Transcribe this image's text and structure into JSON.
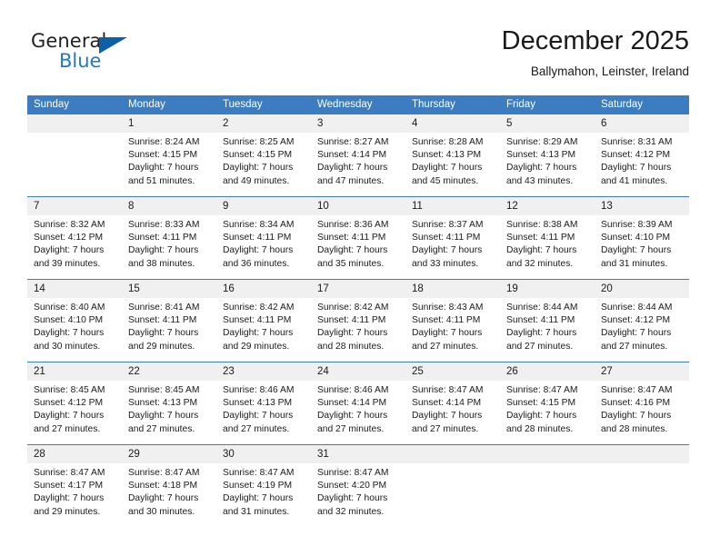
{
  "brand": {
    "name_part1": "General",
    "name_part2": "Blue",
    "triangle_color": "#0d5fa8",
    "blue_color": "#2079c7"
  },
  "header": {
    "title": "December 2025",
    "location": "Ballymahon, Leinster, Ireland"
  },
  "theme": {
    "header_row_bg": "#3c7cc0",
    "daynum_bg": "#f0f0f0",
    "row_divider": "#3c7cc0",
    "text": "#1a1a1a"
  },
  "weekday_headers": [
    "Sunday",
    "Monday",
    "Tuesday",
    "Wednesday",
    "Thursday",
    "Friday",
    "Saturday"
  ],
  "labels": {
    "sunrise_prefix": "Sunrise: ",
    "sunset_prefix": "Sunset: ",
    "daylight_prefix": "Daylight: "
  },
  "weeks": [
    [
      {
        "day": "",
        "blank": true,
        "line1": "",
        "line2": "",
        "line3": "",
        "line4": ""
      },
      {
        "day": "1",
        "line1": "Sunrise: 8:24 AM",
        "line2": "Sunset: 4:15 PM",
        "line3": "Daylight: 7 hours",
        "line4": "and 51 minutes."
      },
      {
        "day": "2",
        "line1": "Sunrise: 8:25 AM",
        "line2": "Sunset: 4:15 PM",
        "line3": "Daylight: 7 hours",
        "line4": "and 49 minutes."
      },
      {
        "day": "3",
        "line1": "Sunrise: 8:27 AM",
        "line2": "Sunset: 4:14 PM",
        "line3": "Daylight: 7 hours",
        "line4": "and 47 minutes."
      },
      {
        "day": "4",
        "line1": "Sunrise: 8:28 AM",
        "line2": "Sunset: 4:13 PM",
        "line3": "Daylight: 7 hours",
        "line4": "and 45 minutes."
      },
      {
        "day": "5",
        "line1": "Sunrise: 8:29 AM",
        "line2": "Sunset: 4:13 PM",
        "line3": "Daylight: 7 hours",
        "line4": "and 43 minutes."
      },
      {
        "day": "6",
        "line1": "Sunrise: 8:31 AM",
        "line2": "Sunset: 4:12 PM",
        "line3": "Daylight: 7 hours",
        "line4": "and 41 minutes."
      }
    ],
    [
      {
        "day": "7",
        "line1": "Sunrise: 8:32 AM",
        "line2": "Sunset: 4:12 PM",
        "line3": "Daylight: 7 hours",
        "line4": "and 39 minutes."
      },
      {
        "day": "8",
        "line1": "Sunrise: 8:33 AM",
        "line2": "Sunset: 4:11 PM",
        "line3": "Daylight: 7 hours",
        "line4": "and 38 minutes."
      },
      {
        "day": "9",
        "line1": "Sunrise: 8:34 AM",
        "line2": "Sunset: 4:11 PM",
        "line3": "Daylight: 7 hours",
        "line4": "and 36 minutes."
      },
      {
        "day": "10",
        "line1": "Sunrise: 8:36 AM",
        "line2": "Sunset: 4:11 PM",
        "line3": "Daylight: 7 hours",
        "line4": "and 35 minutes."
      },
      {
        "day": "11",
        "line1": "Sunrise: 8:37 AM",
        "line2": "Sunset: 4:11 PM",
        "line3": "Daylight: 7 hours",
        "line4": "and 33 minutes."
      },
      {
        "day": "12",
        "line1": "Sunrise: 8:38 AM",
        "line2": "Sunset: 4:11 PM",
        "line3": "Daylight: 7 hours",
        "line4": "and 32 minutes."
      },
      {
        "day": "13",
        "line1": "Sunrise: 8:39 AM",
        "line2": "Sunset: 4:10 PM",
        "line3": "Daylight: 7 hours",
        "line4": "and 31 minutes."
      }
    ],
    [
      {
        "day": "14",
        "line1": "Sunrise: 8:40 AM",
        "line2": "Sunset: 4:10 PM",
        "line3": "Daylight: 7 hours",
        "line4": "and 30 minutes."
      },
      {
        "day": "15",
        "line1": "Sunrise: 8:41 AM",
        "line2": "Sunset: 4:11 PM",
        "line3": "Daylight: 7 hours",
        "line4": "and 29 minutes."
      },
      {
        "day": "16",
        "line1": "Sunrise: 8:42 AM",
        "line2": "Sunset: 4:11 PM",
        "line3": "Daylight: 7 hours",
        "line4": "and 29 minutes."
      },
      {
        "day": "17",
        "line1": "Sunrise: 8:42 AM",
        "line2": "Sunset: 4:11 PM",
        "line3": "Daylight: 7 hours",
        "line4": "and 28 minutes."
      },
      {
        "day": "18",
        "line1": "Sunrise: 8:43 AM",
        "line2": "Sunset: 4:11 PM",
        "line3": "Daylight: 7 hours",
        "line4": "and 27 minutes."
      },
      {
        "day": "19",
        "line1": "Sunrise: 8:44 AM",
        "line2": "Sunset: 4:11 PM",
        "line3": "Daylight: 7 hours",
        "line4": "and 27 minutes."
      },
      {
        "day": "20",
        "line1": "Sunrise: 8:44 AM",
        "line2": "Sunset: 4:12 PM",
        "line3": "Daylight: 7 hours",
        "line4": "and 27 minutes."
      }
    ],
    [
      {
        "day": "21",
        "line1": "Sunrise: 8:45 AM",
        "line2": "Sunset: 4:12 PM",
        "line3": "Daylight: 7 hours",
        "line4": "and 27 minutes."
      },
      {
        "day": "22",
        "line1": "Sunrise: 8:45 AM",
        "line2": "Sunset: 4:13 PM",
        "line3": "Daylight: 7 hours",
        "line4": "and 27 minutes."
      },
      {
        "day": "23",
        "line1": "Sunrise: 8:46 AM",
        "line2": "Sunset: 4:13 PM",
        "line3": "Daylight: 7 hours",
        "line4": "and 27 minutes."
      },
      {
        "day": "24",
        "line1": "Sunrise: 8:46 AM",
        "line2": "Sunset: 4:14 PM",
        "line3": "Daylight: 7 hours",
        "line4": "and 27 minutes."
      },
      {
        "day": "25",
        "line1": "Sunrise: 8:47 AM",
        "line2": "Sunset: 4:14 PM",
        "line3": "Daylight: 7 hours",
        "line4": "and 27 minutes."
      },
      {
        "day": "26",
        "line1": "Sunrise: 8:47 AM",
        "line2": "Sunset: 4:15 PM",
        "line3": "Daylight: 7 hours",
        "line4": "and 28 minutes."
      },
      {
        "day": "27",
        "line1": "Sunrise: 8:47 AM",
        "line2": "Sunset: 4:16 PM",
        "line3": "Daylight: 7 hours",
        "line4": "and 28 minutes."
      }
    ],
    [
      {
        "day": "28",
        "line1": "Sunrise: 8:47 AM",
        "line2": "Sunset: 4:17 PM",
        "line3": "Daylight: 7 hours",
        "line4": "and 29 minutes."
      },
      {
        "day": "29",
        "line1": "Sunrise: 8:47 AM",
        "line2": "Sunset: 4:18 PM",
        "line3": "Daylight: 7 hours",
        "line4": "and 30 minutes."
      },
      {
        "day": "30",
        "line1": "Sunrise: 8:47 AM",
        "line2": "Sunset: 4:19 PM",
        "line3": "Daylight: 7 hours",
        "line4": "and 31 minutes."
      },
      {
        "day": "31",
        "line1": "Sunrise: 8:47 AM",
        "line2": "Sunset: 4:20 PM",
        "line3": "Daylight: 7 hours",
        "line4": "and 32 minutes."
      },
      {
        "day": "",
        "blank": true,
        "line1": "",
        "line2": "",
        "line3": "",
        "line4": ""
      },
      {
        "day": "",
        "blank": true,
        "line1": "",
        "line2": "",
        "line3": "",
        "line4": ""
      },
      {
        "day": "",
        "blank": true,
        "line1": "",
        "line2": "",
        "line3": "",
        "line4": ""
      }
    ]
  ]
}
